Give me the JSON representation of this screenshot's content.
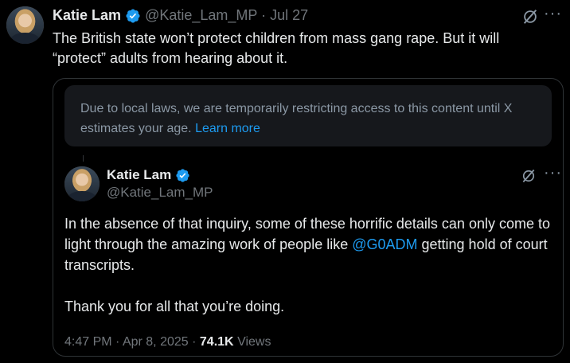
{
  "outer_tweet": {
    "author_name": "Katie Lam",
    "handle": "@Katie_Lam_MP",
    "separator": "·",
    "date": "Jul 27",
    "text": "The British state won’t protect children from mass gang rape. But it will “protect” adults from hearing about it.",
    "more_label": "···"
  },
  "quoted_tweet": {
    "notice_text": "Due to local laws, we are temporarily restricting access to this content until X estimates your age.",
    "notice_link": "Learn more",
    "author_name": "Katie Lam",
    "handle": "@Katie_Lam_MP",
    "more_label": "···",
    "paragraph1_before": "In the absence of that inquiry, some of these horrific details can only come to light through the amazing work of people like ",
    "paragraph1_mention": "@G0ADM",
    "paragraph1_after": " getting hold of court transcripts.",
    "paragraph2": "Thank you for all that you’re doing.",
    "time": "4:47 PM",
    "meta_separator": "·",
    "date": "Apr 8, 2025",
    "views_count": "74.1K",
    "views_label": "Views"
  },
  "colors": {
    "background": "#000000",
    "text": "#e7e9ea",
    "muted": "#71767b",
    "link": "#1d9bf0",
    "verified": "#1d9bf0",
    "notice_bg": "#16181c",
    "border": "#2f3336"
  },
  "icons": [
    "verified-badge-icon",
    "grok-icon",
    "more-icon"
  ]
}
